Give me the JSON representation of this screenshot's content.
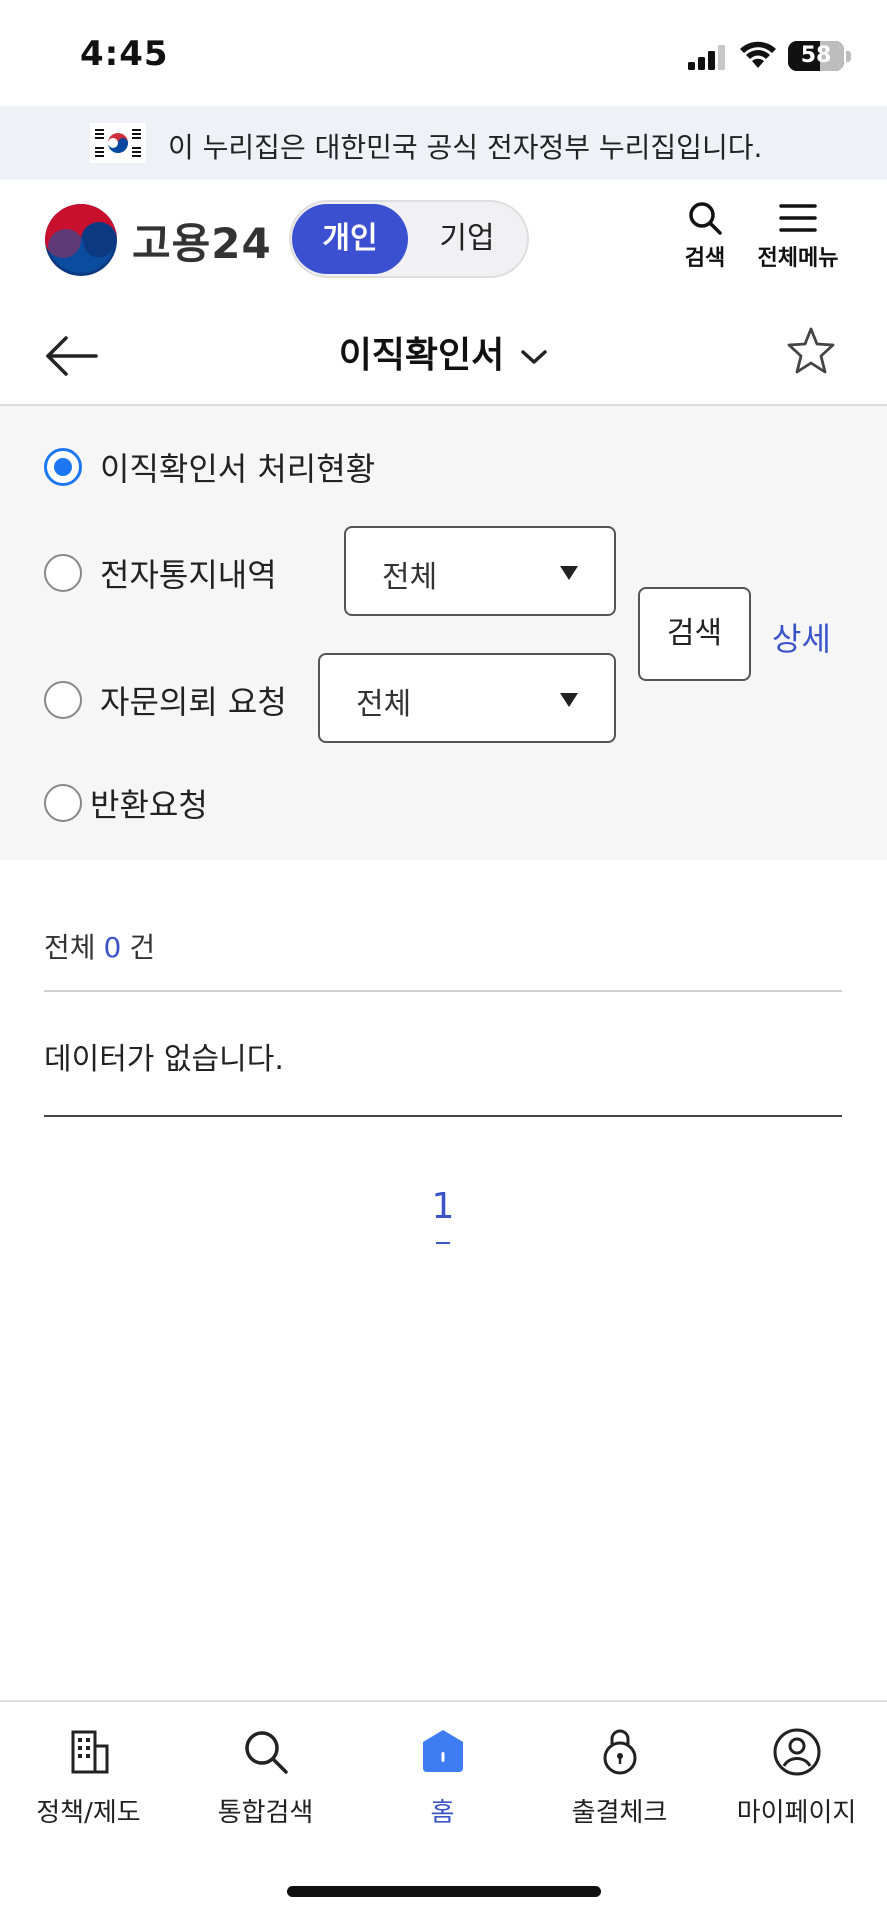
{
  "status_bar": {
    "time": "4:45",
    "battery_level": "58",
    "battery_percent": 58
  },
  "gov_banner": {
    "text": "이 누리집은 대한민국 공식 전자정부 누리집입니다."
  },
  "header": {
    "logo_text": "고용24",
    "toggle": {
      "active": "개인",
      "inactive": "기업"
    },
    "search_label": "검색",
    "menu_label": "전체메뉴",
    "brand_color": "#3b4fd1"
  },
  "page": {
    "title": "이직확인서"
  },
  "filters": {
    "options": [
      {
        "label": "이직확인서 처리현황",
        "checked": true
      },
      {
        "label": "전자통지내역",
        "checked": false
      },
      {
        "label": "자문의뢰 요청",
        "checked": false
      },
      {
        "label": "반환요청",
        "checked": false
      }
    ],
    "select_notice": "전체",
    "select_consult": "전체",
    "search_button": "검색",
    "detail_link": "상세",
    "radio_color": "#1d77f2"
  },
  "results": {
    "total_prefix": "전체",
    "total_count": "0",
    "total_suffix": "건",
    "empty_message": "데이터가 없습니다.",
    "current_page": "1"
  },
  "bottom_nav": {
    "items": [
      {
        "label": "정책/제도",
        "icon": "building-icon",
        "active": false
      },
      {
        "label": "통합검색",
        "icon": "search-icon",
        "active": false
      },
      {
        "label": "홈",
        "icon": "home-icon",
        "active": true
      },
      {
        "label": "출결체크",
        "icon": "lock-icon",
        "active": false
      },
      {
        "label": "마이페이지",
        "icon": "user-icon",
        "active": false
      }
    ],
    "active_color": "#3b55c9"
  }
}
